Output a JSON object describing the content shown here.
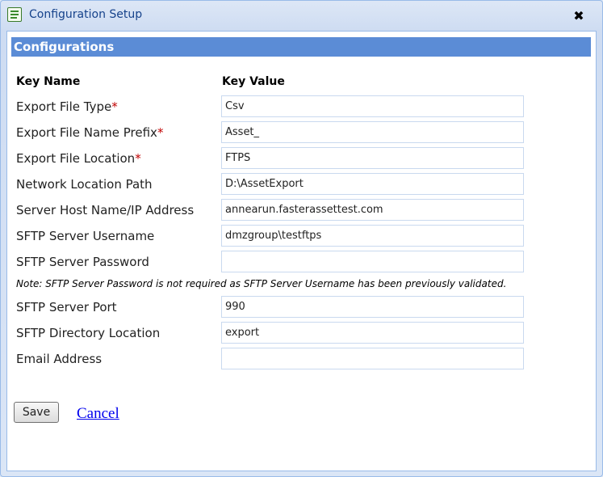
{
  "window": {
    "title": "Configuration Setup",
    "close_symbol": "✖"
  },
  "section": {
    "title": "Configurations"
  },
  "columns": {
    "key_name": "Key Name",
    "key_value": "Key Value"
  },
  "rows": [
    {
      "label": "Export File Type",
      "required": true,
      "value": "Csv"
    },
    {
      "label": "Export File Name Prefix",
      "required": true,
      "value": "Asset_"
    },
    {
      "label": "Export File Location",
      "required": true,
      "value": "FTPS"
    },
    {
      "label": "Network Location Path",
      "required": false,
      "value": "D:\\AssetExport"
    },
    {
      "label": "Server Host Name/IP Address",
      "required": false,
      "value": "annearun.fasterassettest.com"
    },
    {
      "label": "SFTP Server Username",
      "required": false,
      "value": "dmzgroup\\testftps"
    },
    {
      "label": "SFTP Server Password",
      "required": false,
      "value": ""
    },
    {
      "label": "SFTP Server Port",
      "required": false,
      "value": "990"
    },
    {
      "label": "SFTP Directory Location",
      "required": false,
      "value": "export"
    },
    {
      "label": "Email Address",
      "required": false,
      "value": ""
    }
  ],
  "required_marker": "*",
  "note": "Note: SFTP Server Password is not required as SFTP Server Username has been previously validated.",
  "actions": {
    "save_label": "Save",
    "cancel_label": "Cancel"
  }
}
